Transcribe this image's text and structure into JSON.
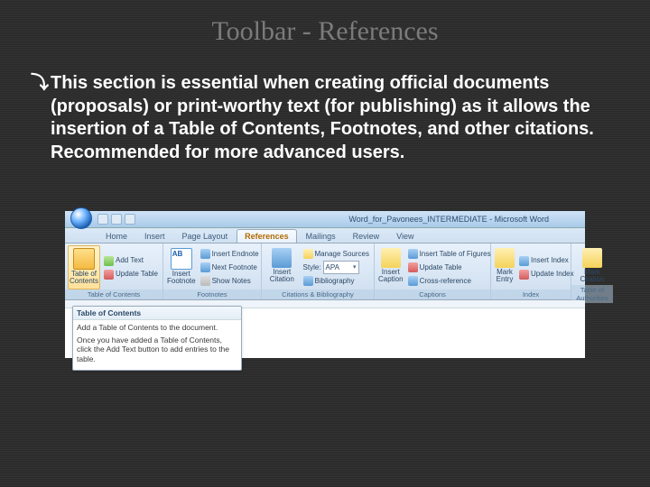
{
  "slide": {
    "title": "Toolbar - References",
    "bullet_glyph": "ན",
    "body": "This section is essential when creating official documents (proposals) or print-worthy text (for publishing) as it allows the insertion of a Table of Contents, Footnotes, and other citations. Recommended for more advanced users."
  },
  "window": {
    "title": "Word_for_Pavonees_INTERMEDIATE - Microsoft Word"
  },
  "tabs": {
    "items": [
      "Home",
      "Insert",
      "Page Layout",
      "References",
      "Mailings",
      "Review",
      "View"
    ],
    "active_index": 3
  },
  "ribbon": {
    "toc": {
      "big": "Table of\nContents",
      "add_text": "Add Text",
      "update": "Update Table",
      "label": "Table of Contents"
    },
    "footnotes": {
      "big": "Insert\nFootnote",
      "endnote": "Insert Endnote",
      "next": "Next Footnote",
      "show": "Show Notes",
      "label": "Footnotes"
    },
    "citations": {
      "big": "Insert\nCitation",
      "manage": "Manage Sources",
      "style_label": "Style:",
      "style_value": "APA",
      "biblio": "Bibliography",
      "label": "Citations & Bibliography"
    },
    "captions": {
      "big": "Insert\nCaption",
      "tof": "Insert Table of Figures",
      "update": "Update Table",
      "xref": "Cross-reference",
      "label": "Captions"
    },
    "index": {
      "big": "Mark\nEntry",
      "insert": "Insert Index",
      "update": "Update Index",
      "label": "Index"
    },
    "toa": {
      "big": "Mark\nCitation",
      "label": "Table of Authorities"
    }
  },
  "callout": {
    "title": "Table of Contents",
    "p1": "Add a Table of Contents to the document.",
    "p2": "Once you have added a Table of Contents, click the Add Text button to add entries to the table."
  }
}
